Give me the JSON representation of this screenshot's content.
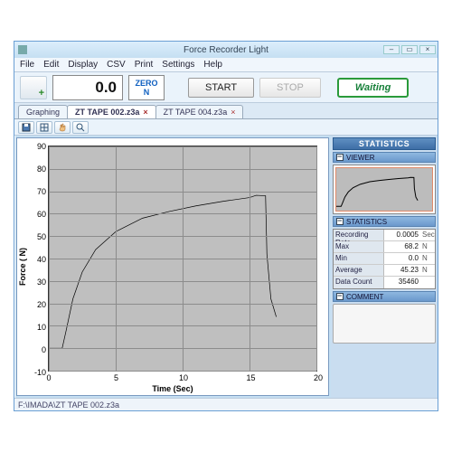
{
  "window": {
    "title": "Force Recorder Light"
  },
  "menu": {
    "items": [
      "File",
      "Edit",
      "Display",
      "CSV",
      "Print",
      "Settings",
      "Help"
    ]
  },
  "toolbar": {
    "readout_value": "0.0",
    "zero_label": "ZERO",
    "unit_label": "N",
    "start_label": "START",
    "stop_label": "STOP",
    "status_label": "Waiting"
  },
  "tabs": {
    "items": [
      {
        "label": "Graphing",
        "closable": false,
        "active": false
      },
      {
        "label": "ZT TAPE 002.z3a",
        "closable": true,
        "active": true
      },
      {
        "label": "ZT TAPE 004.z3a",
        "closable": true,
        "active": false
      }
    ]
  },
  "side": {
    "statistics_header": "STATISTICS",
    "viewer_header": "VIEWER",
    "stats_sub_header": "STATISTICS",
    "comment_header": "COMMENT",
    "stats": [
      {
        "k": "Recording Rate",
        "v": "0.0005",
        "u": "Sec"
      },
      {
        "k": "Max",
        "v": "68.2",
        "u": "N"
      },
      {
        "k": "Min",
        "v": "0.0",
        "u": "N"
      },
      {
        "k": "Average",
        "v": "45.23",
        "u": "N"
      },
      {
        "k": "Data Count",
        "v": "35460",
        "u": ""
      }
    ]
  },
  "statusbar": {
    "text": "F:\\IMADA\\ZT TAPE 002.z3a"
  },
  "chart_data": {
    "type": "line",
    "title": "",
    "xlabel": "Time (Sec)",
    "ylabel": "Force ( N)",
    "xlim": [
      0,
      20
    ],
    "ylim": [
      -10,
      90
    ],
    "xticks": [
      0,
      5,
      10,
      15,
      20
    ],
    "yticks": [
      -10,
      0,
      10,
      20,
      30,
      40,
      50,
      60,
      70,
      80,
      90
    ],
    "grid": true,
    "series": [
      {
        "name": "Force",
        "x": [
          0.0,
          1.0,
          1.3,
          1.8,
          2.5,
          3.5,
          5.0,
          7.0,
          9.0,
          11.0,
          13.0,
          15.0,
          15.5,
          16.2,
          16.3,
          16.6,
          17.0
        ],
        "y": [
          0.0,
          0.0,
          8.0,
          22.0,
          34.0,
          44.0,
          52.0,
          58.0,
          61.0,
          63.5,
          65.5,
          67.2,
          68.2,
          68.0,
          42.0,
          22.0,
          14.0
        ]
      }
    ]
  }
}
